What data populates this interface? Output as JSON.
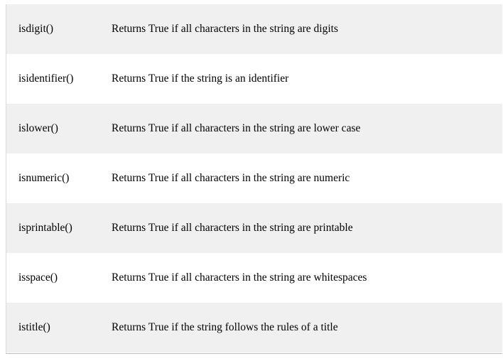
{
  "methods_table": {
    "rows": [
      {
        "method": "isdigit()",
        "description": "Returns True if all characters in the string are digits"
      },
      {
        "method": "isidentifier()",
        "description": "Returns True if the string is an identifier"
      },
      {
        "method": "islower()",
        "description": "Returns True if all characters in the string are lower case"
      },
      {
        "method": "isnumeric()",
        "description": "Returns True if all characters in the string are numeric"
      },
      {
        "method": "isprintable()",
        "description": "Returns True if all characters in the string are printable"
      },
      {
        "method": "isspace()",
        "description": "Returns True if all characters in the string are whitespaces"
      },
      {
        "method": "istitle()",
        "description": "Returns True if the string follows the rules of a title"
      }
    ]
  }
}
